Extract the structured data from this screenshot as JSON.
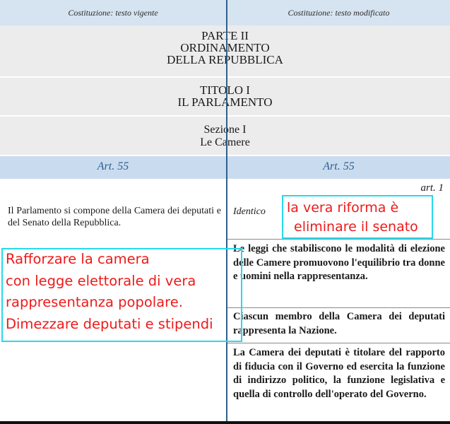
{
  "header": {
    "left": "Costituzione: testo vigente",
    "right": "Costituzione: testo modificato"
  },
  "parte": [
    "PARTE II",
    "ORDINAMENTO",
    "DELLA REPUBBLICA"
  ],
  "titolo": [
    "TITOLO I",
    "IL PARLAMENTO"
  ],
  "sezione": [
    "Sezione I",
    "Le Camere"
  ],
  "article": {
    "left": "Art. 55",
    "right": "Art. 55"
  },
  "art_num": "art. 1",
  "left_col": {
    "text": "Il Parlamento si compone della Camera dei deputati e del Senato della Repubblica."
  },
  "right_col": {
    "identico": "Identico",
    "para1": "Le leggi che stabiliscono le modalità di elezione delle Camere promuovono l'equilibrio tra donne e uomini nella rappresentanza.",
    "para2": "Ciascun membro della Camera dei deputati rappresenta la Nazione.",
    "para3": "La Camera dei deputati è titolare del rapporto di fiducia con il Governo ed esercita la funzione di indirizzo politico, la funzione legislativa e quella di controllo dell'operato del Governo."
  },
  "annotations": {
    "top_right": [
      "la vera riforma è",
      "eliminare il senato"
    ],
    "left": [
      "Rafforzare la camera",
      "con legge elettorale di vera",
      "rappresentanza popolare.",
      "Dimezzare deputati e stipendi"
    ]
  },
  "colors": {
    "header_bg": "#d6e3f0",
    "grey_band": "#ececec",
    "article_band": "#c9dcef",
    "divider": "#2f5f8a",
    "annotation_text": "#ee1a1a",
    "annotation_box": "#27d9ec"
  }
}
